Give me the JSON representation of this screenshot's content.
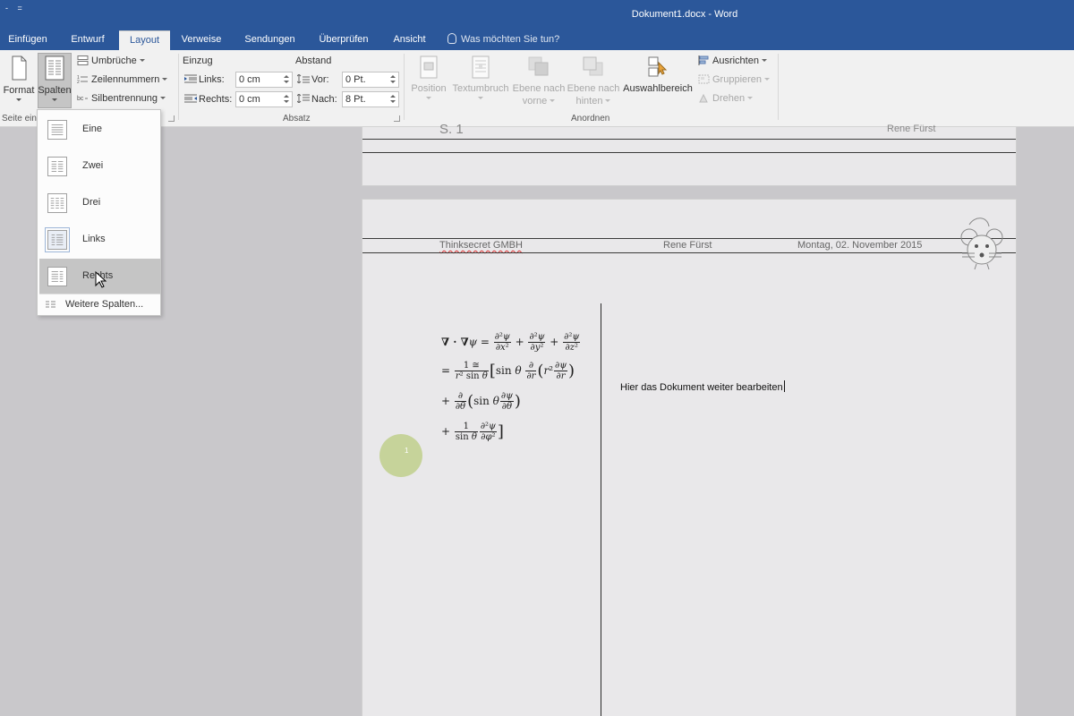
{
  "window": {
    "title": "Dokument1.docx - Word",
    "qat": [
      "-",
      "="
    ]
  },
  "tabs": [
    {
      "label": "Einfügen",
      "active": false
    },
    {
      "label": "Entwurf",
      "active": false
    },
    {
      "label": "Layout",
      "active": true
    },
    {
      "label": "Verweise",
      "active": false
    },
    {
      "label": "Sendungen",
      "active": false
    },
    {
      "label": "Überprüfen",
      "active": false
    },
    {
      "label": "Ansicht",
      "active": false
    }
  ],
  "tell_me": "Was möchten Sie tun?",
  "ribbon": {
    "seite": {
      "format_label": "Format",
      "spalten_label": "Spalten",
      "umbrueche_label": "Umbrüche",
      "zeilennummern_label": "Zeilennummern",
      "silbentrennung_label": "Silbentrennung",
      "group_label": "Seite ein"
    },
    "absatz": {
      "einzug_label": "Einzug",
      "abstand_label": "Abstand",
      "links_label": "Links:",
      "links_value": "0 cm",
      "rechts_label": "Rechts:",
      "rechts_value": "0 cm",
      "vor_label": "Vor:",
      "vor_value": "0 Pt.",
      "nach_label": "Nach:",
      "nach_value": "8 Pt.",
      "group_label": "Absatz"
    },
    "anordnen": {
      "position_label": "Position",
      "textumbruch_label": "Textumbruch",
      "ebene_vorne_line1": "Ebene nach",
      "ebene_vorne_line2": "vorne",
      "ebene_hinten_line1": "Ebene nach",
      "ebene_hinten_line2": "hinten",
      "auswahlbereich_label": "Auswahlbereich",
      "ausrichten_label": "Ausrichten",
      "gruppieren_label": "Gruppieren",
      "drehen_label": "Drehen",
      "group_label": "Anordnen"
    }
  },
  "columns_menu": {
    "items": [
      {
        "label": "Eine"
      },
      {
        "label": "Zwei"
      },
      {
        "label": "Drei"
      },
      {
        "label": "Links"
      },
      {
        "label": "Rechts"
      }
    ],
    "more_label": "Weitere Spalten..."
  },
  "document": {
    "prev_page_footer_left": "S. 1",
    "prev_page_footer_right": "Rene Fürst",
    "header_company": "Thinksecret GMBH",
    "header_author": "Rene Fürst",
    "header_date": "Montag, 02. November 2015",
    "body_text": "Hier das Dokument weiter bearbeiten",
    "click_indicator": "1"
  },
  "colors": {
    "title_bar": "#2b579a",
    "ribbon_bg": "#f1f1f1",
    "canvas_bg": "#c9c8cb",
    "page_bg": "#e9e8ea",
    "menu_hover": "#c5c5c5"
  }
}
